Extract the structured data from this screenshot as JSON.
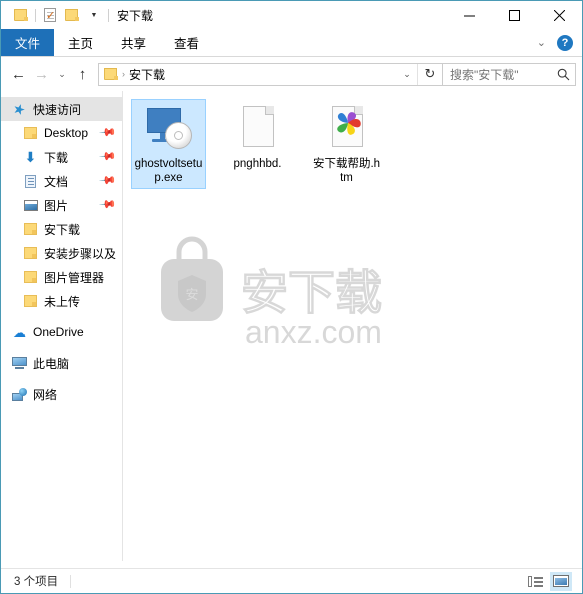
{
  "window": {
    "title": "安下载",
    "quick_access_toolbar": [
      {
        "icon": "folder-icon",
        "name": "properties-folder"
      },
      {
        "icon": "properties-icon",
        "name": "properties"
      },
      {
        "icon": "new-folder-icon",
        "name": "new-folder"
      },
      {
        "icon": "chevron-down-icon",
        "name": "customize-qat"
      }
    ],
    "controls": {
      "minimize": "—",
      "maximize": "☐",
      "close": "✕"
    }
  },
  "ribbon": {
    "tabs": [
      {
        "label": "文件",
        "active": true
      },
      {
        "label": "主页",
        "active": false
      },
      {
        "label": "共享",
        "active": false
      },
      {
        "label": "查看",
        "active": false
      }
    ],
    "collapse_icon": "chevron-down-icon",
    "help_label": "?"
  },
  "address": {
    "back_icon": "←",
    "forward_icon": "→",
    "recent_icon": "⌄",
    "up_icon": "↑",
    "crumb_separator": "›",
    "path": "安下载",
    "dropdown_icon": "⌄",
    "refresh_icon": "↻"
  },
  "search": {
    "placeholder": "搜索\"安下载\"",
    "icon": "search-icon"
  },
  "sidebar": {
    "items": [
      {
        "label": "快速访问",
        "icon": "star-icon",
        "selected": true,
        "indent": false,
        "pinned": false,
        "group": false
      },
      {
        "label": "Desktop",
        "icon": "folder-icon",
        "selected": false,
        "indent": true,
        "pinned": true,
        "group": false
      },
      {
        "label": "下载",
        "icon": "download-icon",
        "selected": false,
        "indent": true,
        "pinned": true,
        "group": false
      },
      {
        "label": "文档",
        "icon": "documents-icon",
        "selected": false,
        "indent": true,
        "pinned": true,
        "group": false
      },
      {
        "label": "图片",
        "icon": "pictures-icon",
        "selected": false,
        "indent": true,
        "pinned": true,
        "group": false
      },
      {
        "label": "安下载",
        "icon": "folder-icon",
        "selected": false,
        "indent": true,
        "pinned": false,
        "group": false
      },
      {
        "label": "安装步骤以及",
        "icon": "folder-icon",
        "selected": false,
        "indent": true,
        "pinned": false,
        "group": false
      },
      {
        "label": "图片管理器",
        "icon": "folder-icon",
        "selected": false,
        "indent": true,
        "pinned": false,
        "group": false
      },
      {
        "label": "未上传",
        "icon": "folder-icon",
        "selected": false,
        "indent": true,
        "pinned": false,
        "group": false
      },
      {
        "label": "OneDrive",
        "icon": "cloud-icon",
        "selected": false,
        "indent": false,
        "pinned": false,
        "group": true
      },
      {
        "label": "此电脑",
        "icon": "this-pc-icon",
        "selected": false,
        "indent": false,
        "pinned": false,
        "group": true
      },
      {
        "label": "网络",
        "icon": "network-icon",
        "selected": false,
        "indent": false,
        "pinned": false,
        "group": true
      }
    ]
  },
  "files": [
    {
      "name": "ghostvoltsetup.exe",
      "icon": "executable-icon",
      "selected": true
    },
    {
      "name": "pnghhbd.",
      "icon": "blank-document-icon",
      "selected": false
    },
    {
      "name": "安下载帮助.htm",
      "icon": "html-document-icon",
      "selected": false
    }
  ],
  "watermark": {
    "shield_text": "安",
    "brand": "安下载",
    "domain": "anxz.com"
  },
  "statusbar": {
    "count": "3 个项目",
    "views": [
      {
        "name": "details-view",
        "active": false
      },
      {
        "name": "large-icons-view",
        "active": true
      }
    ]
  },
  "colors": {
    "accent": "#1e70b8",
    "selection": "#cce8ff",
    "window_border": "#4a9ab5",
    "folder": "#fcd978"
  }
}
